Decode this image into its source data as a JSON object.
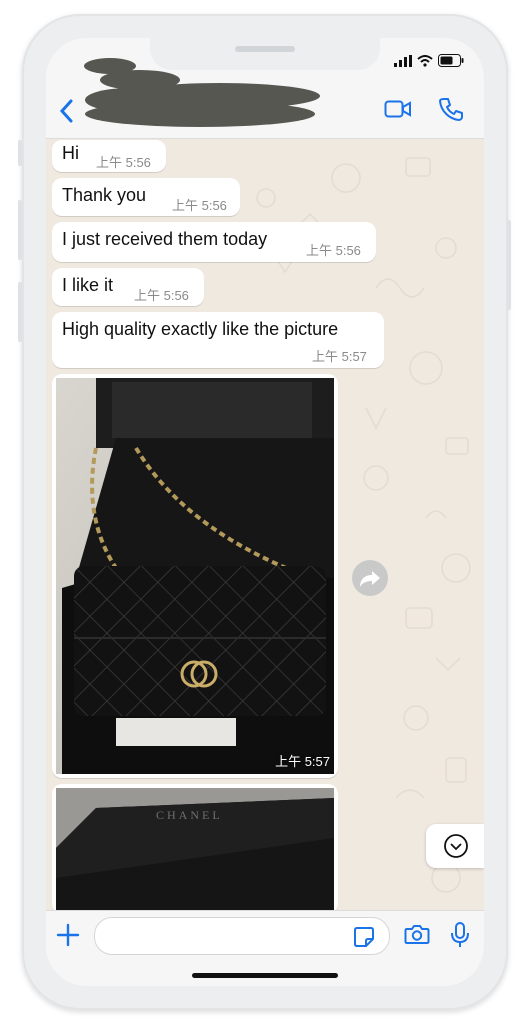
{
  "header": {
    "contact_name": "",
    "back_icon": "chevron-left-icon",
    "video_icon": "video-camera-icon",
    "call_icon": "phone-icon"
  },
  "status_bar": {
    "signal_icon": "signal-icon",
    "wifi_icon": "wifi-icon",
    "battery_icon": "battery-icon"
  },
  "messages": [
    {
      "text": "Hi",
      "time": "上午 5:56"
    },
    {
      "text": "Thank you",
      "time": "上午 5:56"
    },
    {
      "text": "I just received them today",
      "time": "上午 5:56"
    },
    {
      "text": "I like it",
      "time": "上午 5:56"
    },
    {
      "text": "High quality exactly like the picture",
      "time": "上午 5:57"
    }
  ],
  "image_messages": [
    {
      "time": "上午 5:57",
      "content": "quilted-black-bag-photo"
    },
    {
      "box_brand": "CHANEL",
      "content": "black-box-photo"
    }
  ],
  "composer": {
    "placeholder": "",
    "plus_icon": "plus-icon",
    "sticker_icon": "sticker-icon",
    "camera_icon": "camera-icon",
    "mic_icon": "microphone-icon"
  },
  "colors": {
    "accent": "#1a73e8",
    "chat_bg": "#efe9e0",
    "bubble": "#ffffff"
  }
}
